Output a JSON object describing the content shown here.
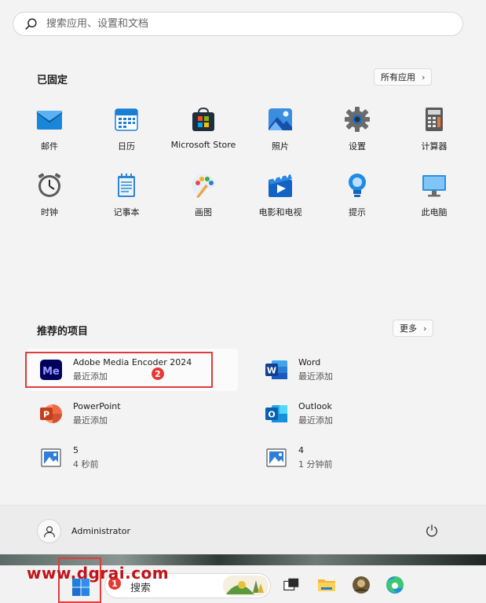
{
  "search": {
    "placeholder": "搜索应用、设置和文档"
  },
  "pinned": {
    "title": "已固定",
    "all_apps_label": "所有应用",
    "apps": [
      {
        "label": "邮件",
        "icon": "mail-icon"
      },
      {
        "label": "日历",
        "icon": "calendar-icon"
      },
      {
        "label": "Microsoft Store",
        "icon": "store-icon"
      },
      {
        "label": "照片",
        "icon": "photos-icon"
      },
      {
        "label": "设置",
        "icon": "gear-icon"
      },
      {
        "label": "计算器",
        "icon": "calculator-icon"
      },
      {
        "label": "时钟",
        "icon": "clock-icon"
      },
      {
        "label": "记事本",
        "icon": "notepad-icon"
      },
      {
        "label": "画图",
        "icon": "paint-icon"
      },
      {
        "label": "电影和电视",
        "icon": "movies-icon"
      },
      {
        "label": "提示",
        "icon": "tips-icon"
      },
      {
        "label": "此电脑",
        "icon": "computer-icon"
      }
    ]
  },
  "recommended": {
    "title": "推荐的项目",
    "more_label": "更多",
    "items": [
      {
        "name": "Adobe Media Encoder 2024",
        "sub": "最近添加",
        "icon": "media-encoder-icon"
      },
      {
        "name": "Word",
        "sub": "最近添加",
        "icon": "word-icon"
      },
      {
        "name": "PowerPoint",
        "sub": "最近添加",
        "icon": "powerpoint-icon"
      },
      {
        "name": "Outlook",
        "sub": "最近添加",
        "icon": "outlook-icon"
      },
      {
        "name": "5",
        "sub": "4 秒前",
        "icon": "image-file-icon"
      },
      {
        "name": "4",
        "sub": "1 分钟前",
        "icon": "image-file-icon"
      }
    ]
  },
  "user": {
    "name": "Administrator"
  },
  "taskbar": {
    "search_label": "搜索"
  },
  "annotations": {
    "step1": "1",
    "step2": "2"
  },
  "watermark": "www.dgrai.com",
  "colors": {
    "accent": "#0067c0",
    "highlight": "#e23b3b"
  }
}
